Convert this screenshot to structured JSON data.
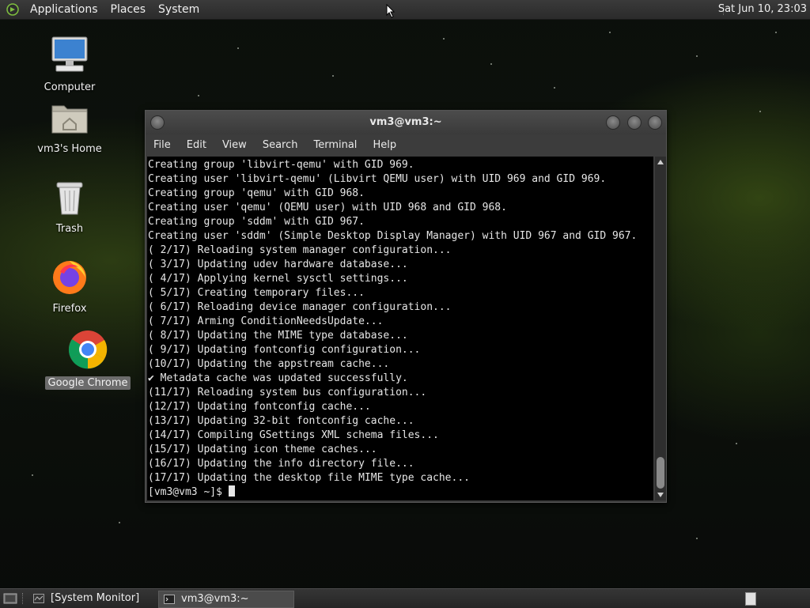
{
  "top_panel": {
    "menus": [
      "Applications",
      "Places",
      "System"
    ],
    "clock": "Sat Jun 10, 23:03"
  },
  "desktop_icons": [
    {
      "label": "Computer",
      "icon": "computer-icon"
    },
    {
      "label": "vm3's Home",
      "icon": "home-folder-icon"
    },
    {
      "label": "Trash",
      "icon": "trash-icon"
    },
    {
      "label": "Firefox",
      "icon": "firefox-icon"
    },
    {
      "label": "Google Chrome",
      "icon": "chrome-icon"
    }
  ],
  "terminal": {
    "title": "vm3@vm3:~",
    "menus": [
      "File",
      "Edit",
      "View",
      "Search",
      "Terminal",
      "Help"
    ],
    "lines": [
      "Creating group 'libvirt-qemu' with GID 969.",
      "Creating user 'libvirt-qemu' (Libvirt QEMU user) with UID 969 and GID 969.",
      "Creating group 'qemu' with GID 968.",
      "Creating user 'qemu' (QEMU user) with UID 968 and GID 968.",
      "Creating group 'sddm' with GID 967.",
      "Creating user 'sddm' (Simple Desktop Display Manager) with UID 967 and GID 967.",
      "( 2/17) Reloading system manager configuration...",
      "( 3/17) Updating udev hardware database...",
      "( 4/17) Applying kernel sysctl settings...",
      "( 5/17) Creating temporary files...",
      "( 6/17) Reloading device manager configuration...",
      "( 7/17) Arming ConditionNeedsUpdate...",
      "( 8/17) Updating the MIME type database...",
      "( 9/17) Updating fontconfig configuration...",
      "(10/17) Updating the appstream cache...",
      "✔ Metadata cache was updated successfully.",
      "(11/17) Reloading system bus configuration...",
      "(12/17) Updating fontconfig cache...",
      "(13/17) Updating 32-bit fontconfig cache...",
      "(14/17) Compiling GSettings XML schema files...",
      "(15/17) Updating icon theme caches...",
      "(16/17) Updating the info directory file...",
      "(17/17) Updating the desktop file MIME type cache..."
    ],
    "prompt": "[vm3@vm3 ~]$ "
  },
  "taskbar": {
    "tasks": [
      "[System Monitor]",
      "vm3@vm3:~"
    ]
  },
  "colors": {
    "panel": "#2b2b2b",
    "terminal_bg": "#000000",
    "terminal_fg": "#e6e6e6"
  }
}
